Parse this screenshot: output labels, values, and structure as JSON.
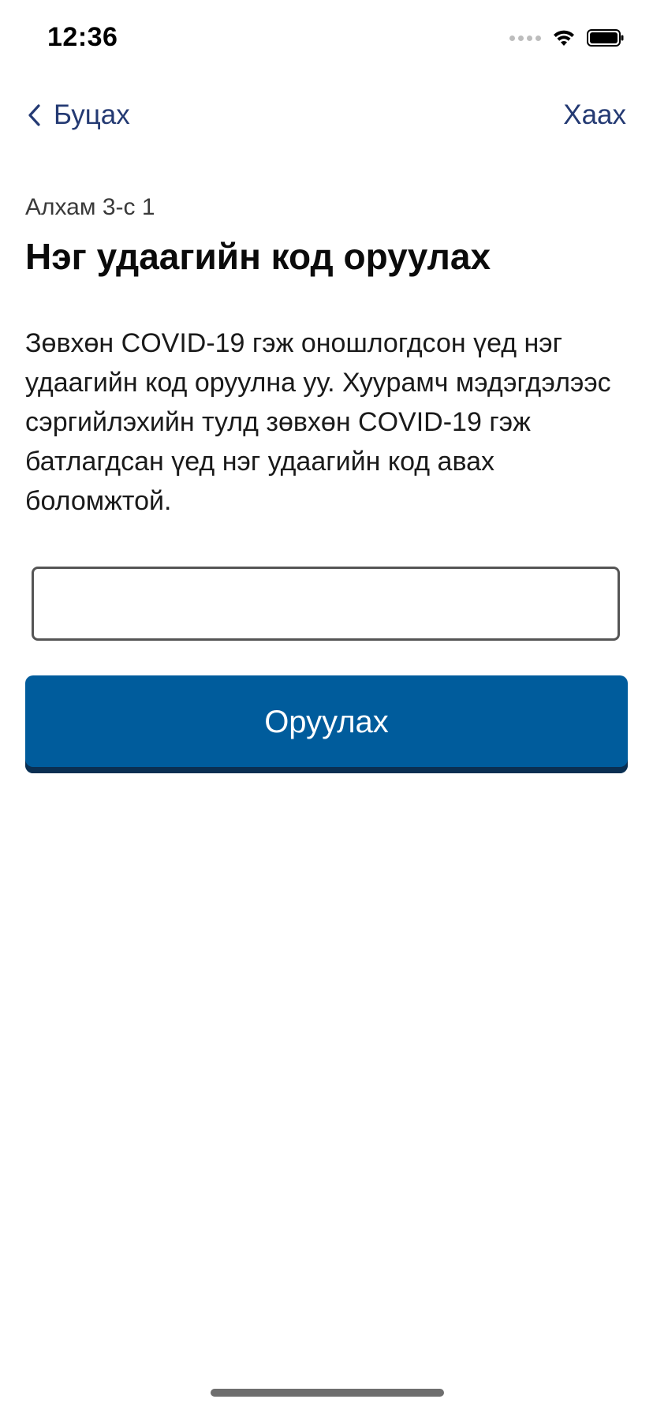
{
  "status_bar": {
    "time": "12:36",
    "icons": [
      "signal-icon",
      "wifi-icon",
      "battery-icon"
    ]
  },
  "nav": {
    "back_label": "Буцах",
    "close_label": "Хаах",
    "back_icon": "chevron-left-icon"
  },
  "content": {
    "step": "Алхам 3-с 1",
    "title": "Нэг удаагийн код оруулах",
    "description": "Зөвхөн COVID-19 гэж оношлогдсон үед нэг удаагийн код оруулна уу. Хуурамч мэдэгдэлээс сэргийлэхийн тулд зөвхөн COVID-19 гэж батлагдсан үед нэг удаагийн код авах боломжтой.",
    "code_input_value": "",
    "submit_label": "Оруулах"
  },
  "colors": {
    "accent": "#243a73",
    "button": "#005c9c",
    "button_shadow": "#0a2f52"
  }
}
